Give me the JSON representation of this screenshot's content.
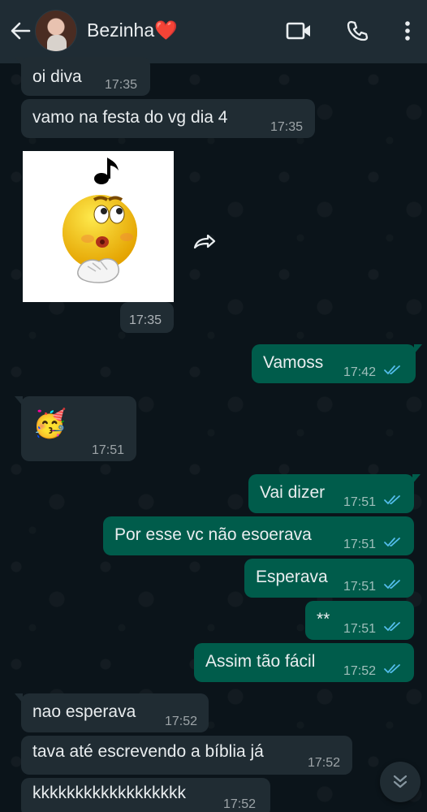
{
  "header": {
    "contact_name": "Bezinha❤️",
    "icons": [
      "back-arrow-icon",
      "video-call-icon",
      "phone-call-icon",
      "more-options-icon"
    ]
  },
  "messages": [
    {
      "dir": "in",
      "text": "oi diva",
      "time": "17:35"
    },
    {
      "dir": "in",
      "text": "vamo na festa do vg dia 4",
      "time": "17:35"
    },
    {
      "dir": "in",
      "type": "sticker",
      "sticker": "whistling-emoji-with-music-note",
      "time": "17:35"
    },
    {
      "dir": "out",
      "text": "Vamoss",
      "time": "17:42",
      "status": "read"
    },
    {
      "dir": "in",
      "text": "🥳",
      "time": "17:51"
    },
    {
      "dir": "out",
      "text": "Vai dizer",
      "time": "17:51",
      "status": "read"
    },
    {
      "dir": "out",
      "text": "Por esse vc não esoerava",
      "time": "17:51",
      "status": "read"
    },
    {
      "dir": "out",
      "text": "Esperava",
      "time": "17:51",
      "status": "read"
    },
    {
      "dir": "out",
      "text": "**",
      "time": "17:51",
      "status": "read"
    },
    {
      "dir": "out",
      "text": "Assim tão fácil",
      "time": "17:52",
      "status": "read"
    },
    {
      "dir": "in",
      "text": "nao esperava",
      "time": "17:52"
    },
    {
      "dir": "in",
      "text": "tava até escrevendo a bíblia já",
      "time": "17:52"
    },
    {
      "dir": "in",
      "text": "kkkkkkkkkkkkkkkkkk",
      "time": "17:52"
    }
  ],
  "colors": {
    "header_bg": "#1f2c34",
    "chat_bg": "#0b141a",
    "incoming_bubble": "#202c33",
    "outgoing_bubble": "#005c4b",
    "read_ticks": "#53bdeb"
  }
}
